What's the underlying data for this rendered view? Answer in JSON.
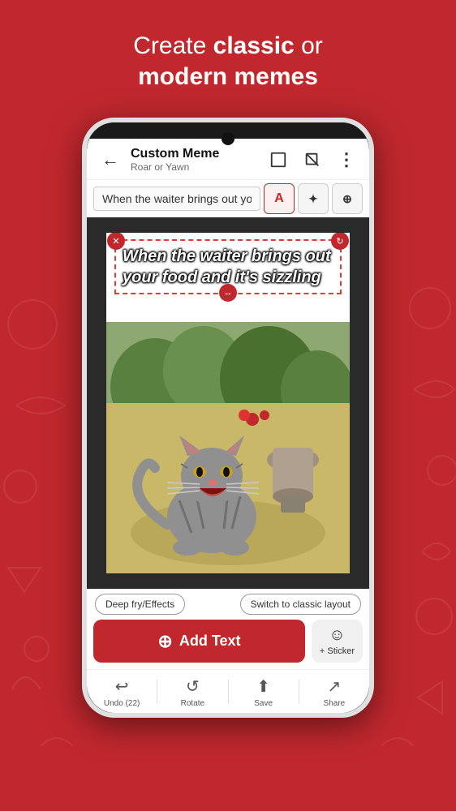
{
  "header": {
    "line1_normal": "Create ",
    "line1_bold": "classic",
    "line1_end": " or",
    "line2": "modern memes"
  },
  "app_bar": {
    "back_icon": "←",
    "title": "Custom Meme",
    "subtitle": "Roar or Yawn",
    "icon_square": "⬜",
    "icon_crop": "⊠",
    "icon_more": "⋮"
  },
  "text_input": {
    "value": "When the waiter brings out your foc",
    "format_icons": [
      "A",
      "✦",
      "⊕"
    ]
  },
  "meme_text": {
    "line1": "When the waiter brings out",
    "line2": "your food and it's sizzling"
  },
  "bottom_controls": {
    "deep_fry_label": "Deep fry/Effects",
    "switch_layout_label": "Switch to classic layout",
    "add_text_label": "Add Text",
    "sticker_label": "+ Sticker"
  },
  "bottom_nav": {
    "items": [
      {
        "icon": "↩",
        "label": "Undo (22)"
      },
      {
        "icon": "↺",
        "label": "Rotate"
      },
      {
        "icon": "⬆",
        "label": "Save"
      },
      {
        "icon": "↗",
        "label": "Share"
      }
    ]
  }
}
